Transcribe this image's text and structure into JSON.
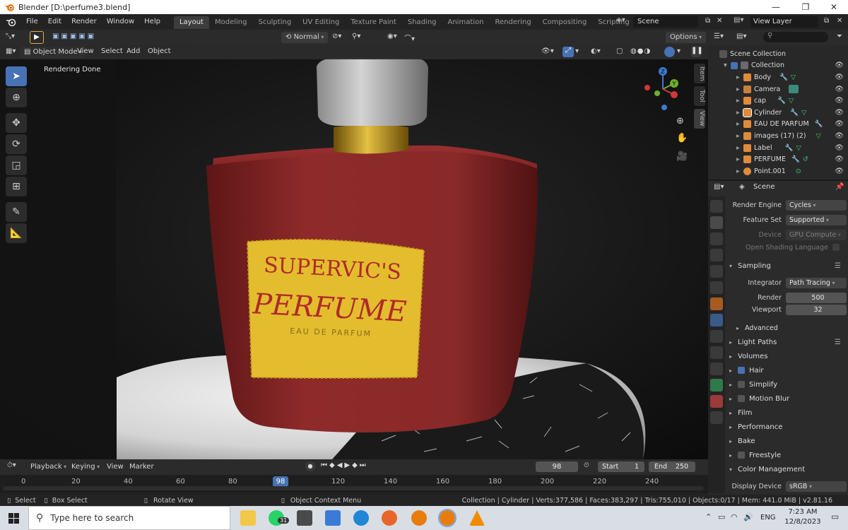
{
  "window": {
    "title": "Blender [D:\\perfume3.blend]"
  },
  "menu": {
    "items": [
      "File",
      "Edit",
      "Render",
      "Window",
      "Help"
    ]
  },
  "workspaces": {
    "tabs": [
      "Layout",
      "Modeling",
      "Sculpting",
      "UV Editing",
      "Texture Paint",
      "Shading",
      "Animation",
      "Rendering",
      "Compositing",
      "Scripting"
    ],
    "add": "+"
  },
  "topright": {
    "scene": "Scene",
    "view_layer": "View Layer"
  },
  "tool_header": {
    "orientation": "Normal",
    "options": "Options"
  },
  "viewport_header": {
    "mode": "Object Mode",
    "items": [
      "View",
      "Select",
      "Add",
      "Object"
    ]
  },
  "viewport": {
    "status": "Rendering Done",
    "label_line1": "SUPERVIC'S",
    "label_line2": "PERFUME",
    "label_line3": "EAU DE PARFUM",
    "side_tabs": [
      "Item",
      "Tool",
      "View"
    ],
    "gizmo": {
      "z": "Z",
      "y": "Y"
    }
  },
  "outliner": {
    "root": "Scene Collection",
    "collection": "Collection",
    "items": [
      {
        "name": "Body",
        "color": "#e08a3c"
      },
      {
        "name": "Camera",
        "color": "#c7813f"
      },
      {
        "name": "cap",
        "color": "#e08a3c"
      },
      {
        "name": "Cylinder",
        "color": "#e08a3c"
      },
      {
        "name": "EAU DE PARFUM",
        "color": "#e08a3c"
      },
      {
        "name": "images (17) (2)",
        "color": "#e08a3c"
      },
      {
        "name": "Label",
        "color": "#e08a3c"
      },
      {
        "name": "PERFUME",
        "color": "#e08a3c"
      },
      {
        "name": "Point.001",
        "color": "#e08a3c"
      }
    ]
  },
  "properties": {
    "context": "Scene",
    "render_engine_label": "Render Engine",
    "render_engine": "Cycles",
    "feature_set_label": "Feature Set",
    "feature_set": "Supported",
    "device_label": "Device",
    "device": "GPU Compute",
    "osl_label": "Open Shading Language",
    "sampling": "Sampling",
    "integrator_label": "Integrator",
    "integrator": "Path Tracing",
    "render_label": "Render",
    "render": "500",
    "viewport_label": "Viewport",
    "viewport": "32",
    "panels": [
      "Advanced",
      "Light Paths",
      "Volumes",
      "Hair",
      "Simplify",
      "Motion Blur",
      "Film",
      "Performance",
      "Bake",
      "Freestyle",
      "Color Management"
    ],
    "display_device_label": "Display Device",
    "display_device": "sRGB"
  },
  "timeline": {
    "menus": [
      "Playback",
      "Keying",
      "View",
      "Marker"
    ],
    "current_frame": "98",
    "start_label": "Start",
    "start": "1",
    "end_label": "End",
    "end": "250",
    "ticks": [
      "0",
      "20",
      "40",
      "60",
      "80",
      "120",
      "140",
      "160",
      "180",
      "200",
      "220",
      "240"
    ],
    "frame_badge": "98",
    "frame_fraction": 0.392
  },
  "statusbar": {
    "select": "Select",
    "box_select": "Box Select",
    "rotate": "Rotate View",
    "context_menu": "Object Context Menu",
    "stats": "Collection | Cylinder | Verts:377,586 | Faces:383,297 | Tris:755,010 | Objects:0/17 | Mem: 441.0 MiB | v2.81.16"
  },
  "taskbar": {
    "search_placeholder": "Type here to search",
    "whatsapp_badge": "31",
    "language": "ENG",
    "time": "7:23 AM",
    "date": "12/8/2023"
  },
  "colors": {
    "accent": "#4772b3",
    "label_gold": "#e3bd2e",
    "bottle_red": "#8e2a2a"
  }
}
